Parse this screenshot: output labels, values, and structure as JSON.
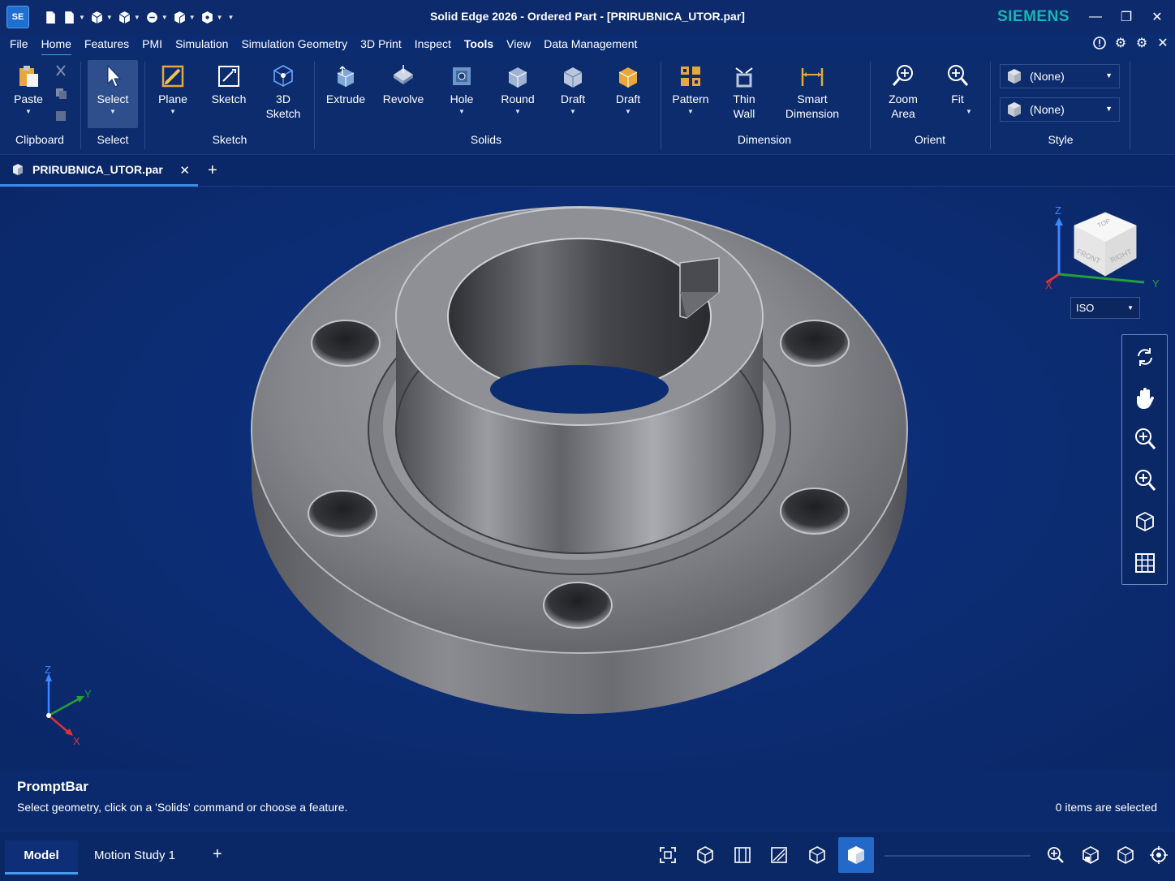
{
  "window": {
    "title": "Solid Edge 2026 - Ordered Part - [PRIRUBNICA_UTOR.par]",
    "brand": "SIEMENS",
    "app_logo": "SE"
  },
  "menu": {
    "items": [
      "File",
      "Home",
      "Features",
      "PMI",
      "Simulation",
      "Simulation Geometry",
      "3D Print",
      "Inspect",
      "Tools",
      "View",
      "Data Management"
    ],
    "active": "Home",
    "bold": "Tools"
  },
  "ribbon": {
    "paste": "Paste",
    "select": "Select",
    "plane": "Plane",
    "sketch": "Sketch",
    "sketch3d_1": "3D",
    "sketch3d_2": "Sketch",
    "extrude": "Extrude",
    "revolve": "Revolve",
    "hole": "Hole",
    "round": "Round",
    "draft1": "Draft",
    "draft2": "Draft",
    "pattern": "Pattern",
    "thin_wall_1": "Thin",
    "thin_wall_2": "Wall",
    "smart_dim_1": "Smart",
    "smart_dim_2": "Dimension",
    "zoom_area_1": "Zoom",
    "zoom_area_2": "Area",
    "fit": "Fit",
    "style_1": "(None)",
    "style_2": "(None)",
    "groups": {
      "clipboard": "Clipboard",
      "select": "Select",
      "sketch": "Sketch",
      "solids": "Solids",
      "dimension": "Dimension",
      "orient": "Orient",
      "style": "Style"
    }
  },
  "document_tab": {
    "name": "PRIRUBNICA_UTOR.par"
  },
  "viewport": {
    "view_orientation": "ISO",
    "view_cube": {
      "top": "TOP",
      "front": "FRONT",
      "right": "RIGHT"
    },
    "axes": {
      "x": "X",
      "y": "Y",
      "z": "Z"
    }
  },
  "promptbar": {
    "title": "PromptBar",
    "message": "Select geometry, click on a 'Solids' command or choose a feature.",
    "selection_count": "0 items are selected"
  },
  "status_tabs": [
    "Model",
    "Motion Study 1"
  ],
  "colors": {
    "background": "#0c2c72",
    "accent": "#4a9af0",
    "brand": "#19b7b3",
    "part_metal": "#8a8c92"
  }
}
